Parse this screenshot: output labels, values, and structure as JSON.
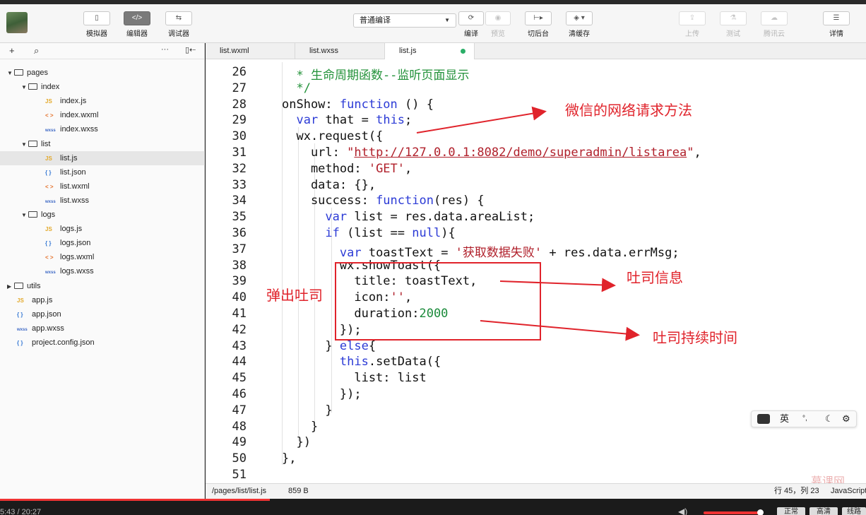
{
  "toolbar": {
    "simulator": "模拟器",
    "editor": "编辑器",
    "debugger": "调试器",
    "compile_mode": "普通编译",
    "compile": "编译",
    "preview": "预览",
    "background": "切后台",
    "clear_cache": "清缓存",
    "upload": "上传",
    "test": "测试",
    "tencent_cloud": "腾讯云",
    "details": "详情",
    "icons": {
      "simulator": "phone-icon",
      "editor": "code-icon",
      "debugger": "debug-icon"
    }
  },
  "sidebar": {
    "tree": [
      {
        "label": "pages",
        "kind": "folder",
        "expanded": true,
        "depth": 0
      },
      {
        "label": "index",
        "kind": "folder",
        "expanded": true,
        "depth": 1
      },
      {
        "label": "index.js",
        "kind": "js",
        "depth": 2
      },
      {
        "label": "index.wxml",
        "kind": "wxml",
        "depth": 2
      },
      {
        "label": "index.wxss",
        "kind": "wxss",
        "depth": 2
      },
      {
        "label": "list",
        "kind": "folder",
        "expanded": true,
        "depth": 1
      },
      {
        "label": "list.js",
        "kind": "js",
        "depth": 2,
        "selected": true
      },
      {
        "label": "list.json",
        "kind": "json",
        "depth": 2
      },
      {
        "label": "list.wxml",
        "kind": "wxml",
        "depth": 2
      },
      {
        "label": "list.wxss",
        "kind": "wxss",
        "depth": 2
      },
      {
        "label": "logs",
        "kind": "folder",
        "expanded": true,
        "depth": 1
      },
      {
        "label": "logs.js",
        "kind": "js",
        "depth": 2
      },
      {
        "label": "logs.json",
        "kind": "json",
        "depth": 2
      },
      {
        "label": "logs.wxml",
        "kind": "wxml",
        "depth": 2
      },
      {
        "label": "logs.wxss",
        "kind": "wxss",
        "depth": 2
      },
      {
        "label": "utils",
        "kind": "folder",
        "expanded": false,
        "depth": 0
      },
      {
        "label": "app.js",
        "kind": "js",
        "depth": 0
      },
      {
        "label": "app.json",
        "kind": "json",
        "depth": 0
      },
      {
        "label": "app.wxss",
        "kind": "wxss",
        "depth": 0
      },
      {
        "label": "project.config.json",
        "kind": "json",
        "depth": 0
      }
    ],
    "type_badges": {
      "js": "JS",
      "json": "{ }",
      "wxml": "< >",
      "wxss": "wxss"
    }
  },
  "tabs": [
    {
      "label": "list.wxml",
      "active": false
    },
    {
      "label": "list.wxss",
      "active": false
    },
    {
      "label": "list.js",
      "active": true,
      "modified": true
    }
  ],
  "editor": {
    "lines": [
      {
        "n": "26",
        "t": "  * 生命周期函数--监听页面显示"
      },
      {
        "n": "27",
        "t": "  */"
      },
      {
        "n": "28",
        "t": "onShow: function () {"
      },
      {
        "n": "29",
        "t": "  var that = this;"
      },
      {
        "n": "30",
        "t": "  wx.request({"
      },
      {
        "n": "31",
        "t": "    url: \"http://127.0.0.1:8082/demo/superadmin/listarea\","
      },
      {
        "n": "32",
        "t": "    method: 'GET',"
      },
      {
        "n": "33",
        "t": "    data: {},"
      },
      {
        "n": "34",
        "t": "    success: function(res) {"
      },
      {
        "n": "35",
        "t": "      var list = res.data.areaList;"
      },
      {
        "n": "36",
        "t": "      if (list == null){"
      },
      {
        "n": "37",
        "t": "        var toastText = '获取数据失败' + res.data.errMsg;"
      },
      {
        "n": "38",
        "t": "        wx.showToast({"
      },
      {
        "n": "39",
        "t": "          title: toastText,"
      },
      {
        "n": "40",
        "t": "          icon:'',"
      },
      {
        "n": "41",
        "t": "          duration:2000"
      },
      {
        "n": "42",
        "t": "        });"
      },
      {
        "n": "43",
        "t": "      } else{"
      },
      {
        "n": "44",
        "t": "        this.setData({"
      },
      {
        "n": "45",
        "t": "          list: list"
      },
      {
        "n": "46",
        "t": "        });"
      },
      {
        "n": "47",
        "t": "      }"
      },
      {
        "n": "48",
        "t": "    }"
      },
      {
        "n": "49",
        "t": "  })"
      },
      {
        "n": "50",
        "t": "},"
      },
      {
        "n": "51",
        "t": ""
      }
    ],
    "colors": {
      "keyword": "#2c3bd6",
      "string": "#b0202b",
      "number": "#1a8a3a",
      "comment": "#23923a"
    }
  },
  "annotations": {
    "request_method": "微信的网络请求方法",
    "show_toast": "弹出吐司",
    "toast_info": "吐司信息",
    "toast_duration": "吐司持续时间",
    "color": "#e0232b"
  },
  "status": {
    "path": "/pages/list/list.js",
    "size": "859 B",
    "cursor": "行 45，列 23",
    "language": "JavaScript"
  },
  "ime": {
    "lang": "英",
    "punct": "°,"
  },
  "video": {
    "time": "5:43 / 20:27",
    "b1": "正常",
    "b2": "高清",
    "b3": "线路"
  },
  "watermark": "慕课网"
}
